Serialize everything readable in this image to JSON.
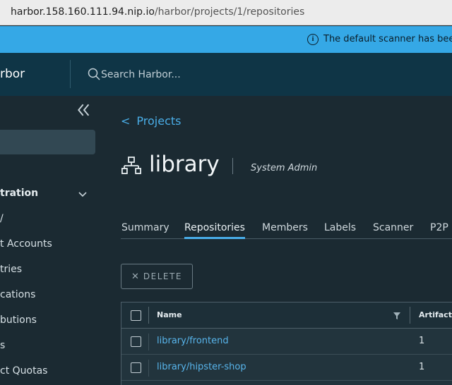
{
  "browser": {
    "url_host": "harbor.158.160.111.94.nip.io",
    "url_path": "/harbor/projects/1/repositories"
  },
  "banner": {
    "icon": "info-icon",
    "message": "The default scanner has beer"
  },
  "header": {
    "brand": "rbor",
    "search_placeholder": "Search Harbor..."
  },
  "sidebar": {
    "collapse_icon": "double-chevron-left-icon",
    "group_label": "tration",
    "items": [
      {
        "label": "t Accounts"
      },
      {
        "label": "tries"
      },
      {
        "label": "cations"
      },
      {
        "label": "butions"
      },
      {
        "label": "s"
      },
      {
        "label": "ct Quotas"
      }
    ]
  },
  "project": {
    "back_label": "Projects",
    "back_symbol": "<",
    "name": "library",
    "role": "System Admin"
  },
  "tabs": [
    {
      "label": "Summary",
      "active": false
    },
    {
      "label": "Repositories",
      "active": true
    },
    {
      "label": "Members",
      "active": false
    },
    {
      "label": "Labels",
      "active": false
    },
    {
      "label": "Scanner",
      "active": false
    },
    {
      "label": "P2P",
      "active": false
    }
  ],
  "toolbar": {
    "delete_label": "DELETE"
  },
  "table": {
    "columns": [
      "Name",
      "Artifacts"
    ],
    "rows": [
      {
        "name": "library/frontend",
        "artifacts": "1"
      },
      {
        "name": "library/hipster-shop",
        "artifacts": "1"
      }
    ]
  },
  "colors": {
    "accent": "#49aeea",
    "banner": "#35a8e6",
    "header": "#0f3546",
    "background": "#1b2a32"
  }
}
